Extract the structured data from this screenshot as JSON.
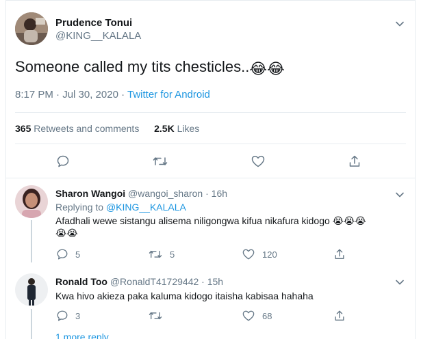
{
  "tweet": {
    "author_name": "Prudence Tonui",
    "author_handle": "@KING__KALALA",
    "text": "Someone called my tits chesticles..",
    "emoji": [
      "😂",
      "😂"
    ],
    "timestamp": "8:17 PM · Jul 30, 2020",
    "separator": " · ",
    "source": "Twitter for Android",
    "retweets_count": "365",
    "retweets_label": "Retweets and comments",
    "likes_count": "2.5K",
    "likes_label": "Likes"
  },
  "replies": [
    {
      "name": "Sharon Wangoi",
      "handle": "@wangoi_sharon",
      "dot": "·",
      "time": "16h",
      "replying_to_label": "Replying to",
      "replying_to_handle": "@KING__KALALA",
      "text": "Afadhali wewe sistangu alisema niligongwa kifua nikafura kidogo",
      "emoji_line1": [
        "😭",
        "😭",
        "😭"
      ],
      "emoji_line2": [
        "😭",
        "😭"
      ],
      "reply_count": "5",
      "retweet_count": "5",
      "like_count": "120"
    },
    {
      "name": "Ronald Too",
      "handle": "@RonaldT41729442",
      "dot": "·",
      "time": "15h",
      "text": "Kwa hivo akieza paka kaluma kidogo itaisha kabisaa hahaha",
      "reply_count": "3",
      "retweet_count": "",
      "like_count": "68"
    }
  ],
  "more_replies_label": "1 more reply",
  "colors": {
    "accent": "#1b95e0",
    "secondary_text": "#657786",
    "border": "#e6ecf0"
  },
  "icons": [
    "chevron-down-icon",
    "reply-icon",
    "retweet-icon",
    "like-icon",
    "share-icon"
  ]
}
